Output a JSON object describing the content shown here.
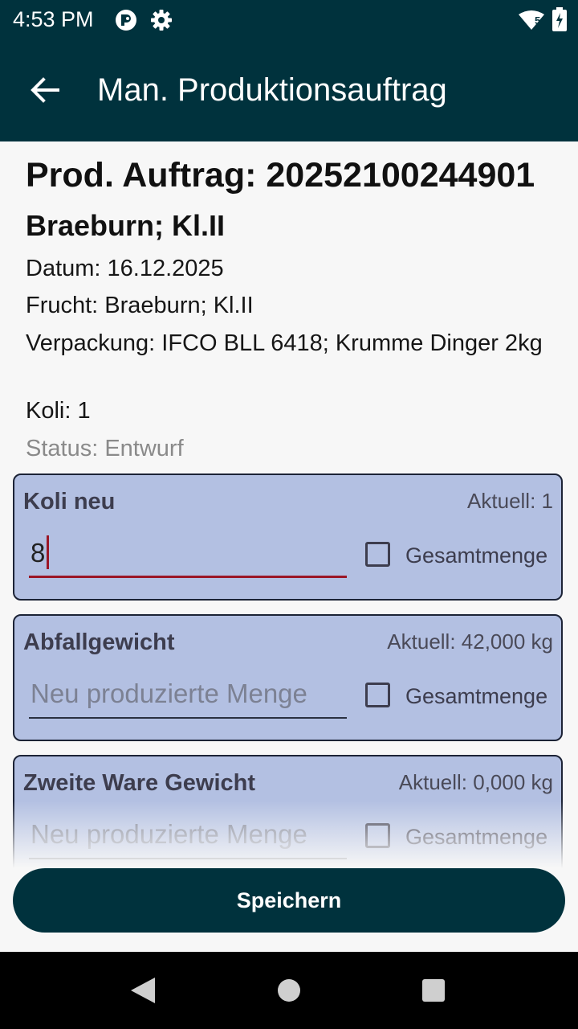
{
  "status_bar": {
    "time": "4:53 PM",
    "network_type": "5",
    "icons": [
      "app-notification-icon",
      "settings-gear-icon",
      "wifi-icon",
      "battery-charging-icon"
    ]
  },
  "app_bar": {
    "title": "Man. Produktionsauftrag",
    "back_icon": "arrow-back-icon"
  },
  "order": {
    "title": "Prod. Auftrag: 20252100244901",
    "subtitle": "Braeburn; Kl.II",
    "date": "Datum: 16.12.2025",
    "fruit": "Frucht: Braeburn; Kl.II",
    "packaging": "Verpackung: IFCO BLL 6418; Krumme Dinger 2kg",
    "koli": "Koli: 1",
    "status": "Status: Entwurf"
  },
  "fields": [
    {
      "label": "Koli neu",
      "current": "Aktuell: 1",
      "value": "8",
      "placeholder": "",
      "checkbox_label": "Gesamtmenge",
      "checked": false
    },
    {
      "label": "Abfallgewicht",
      "current": "Aktuell: 42,000 kg",
      "value": "",
      "placeholder": "Neu produzierte Menge",
      "checkbox_label": "Gesamtmenge",
      "checked": false
    },
    {
      "label": "Zweite Ware Gewicht",
      "current": "Aktuell: 0,000 kg",
      "value": "",
      "placeholder": "Neu produzierte Menge",
      "checkbox_label": "Gesamtmenge",
      "checked": false
    }
  ],
  "actions": {
    "save_label": "Speichern"
  },
  "colors": {
    "primary": "#00323d",
    "card_bg": "#b3c0e2",
    "focus": "#9b1626"
  },
  "nav_bar": {
    "icons": [
      "back-triangle-icon",
      "home-circle-icon",
      "recents-square-icon"
    ]
  }
}
